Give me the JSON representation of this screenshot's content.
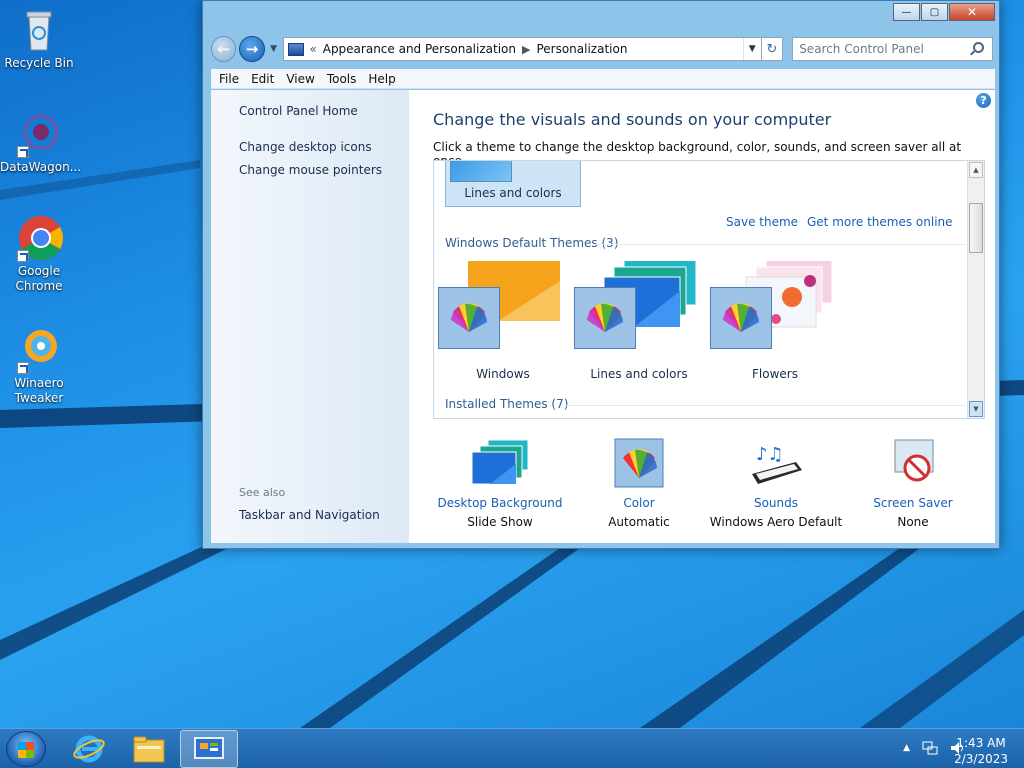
{
  "desktop": {
    "icons": [
      {
        "label": "Recycle Bin",
        "icon": "recycle-bin-icon"
      },
      {
        "label": "DataWagon...",
        "icon": "datawagon-icon"
      },
      {
        "label": "Google Chrome",
        "icon": "chrome-icon"
      },
      {
        "label": "Winaero Tweaker",
        "icon": "winaero-icon"
      }
    ]
  },
  "window": {
    "caption_buttons": {
      "minimize": "—",
      "maximize": "▢",
      "close": "✕"
    },
    "address": {
      "overflow": "«",
      "crumbs": [
        "Appearance and Personalization",
        "Personalization"
      ]
    },
    "search": {
      "placeholder": "Search Control Panel"
    },
    "menu": [
      "File",
      "Edit",
      "View",
      "Tools",
      "Help"
    ]
  },
  "left_pane": {
    "home": "Control Panel Home",
    "links": [
      "Change desktop icons",
      "Change mouse pointers"
    ],
    "see_also_heading": "See also",
    "see_also": [
      "Taskbar and Navigation"
    ]
  },
  "main": {
    "title": "Change the visuals and sounds on your computer",
    "subtitle": "Click a theme to change the desktop background, color, sounds, and screen saver all at once.",
    "selected_theme_label": "Lines and colors",
    "save_theme": "Save theme",
    "more_themes": "Get more themes online",
    "default_section": "Windows Default Themes (3)",
    "default_themes": [
      "Windows",
      "Lines and colors",
      "Flowers"
    ],
    "installed_section": "Installed Themes (7)",
    "help": "?"
  },
  "bottom": [
    {
      "title": "Desktop Background",
      "value": "Slide Show",
      "icon": "desktop-background-icon"
    },
    {
      "title": "Color",
      "value": "Automatic",
      "icon": "color-palette-icon"
    },
    {
      "title": "Sounds",
      "value": "Windows Aero Default",
      "icon": "sounds-icon"
    },
    {
      "title": "Screen Saver",
      "value": "None",
      "icon": "screen-saver-icon"
    }
  ],
  "taskbar": {
    "time": "1:43 AM",
    "date": "2/3/2023",
    "tray_arrow": "▲"
  },
  "colors": {
    "accent": "#1a5fb4",
    "title": "#1e3f6e"
  }
}
